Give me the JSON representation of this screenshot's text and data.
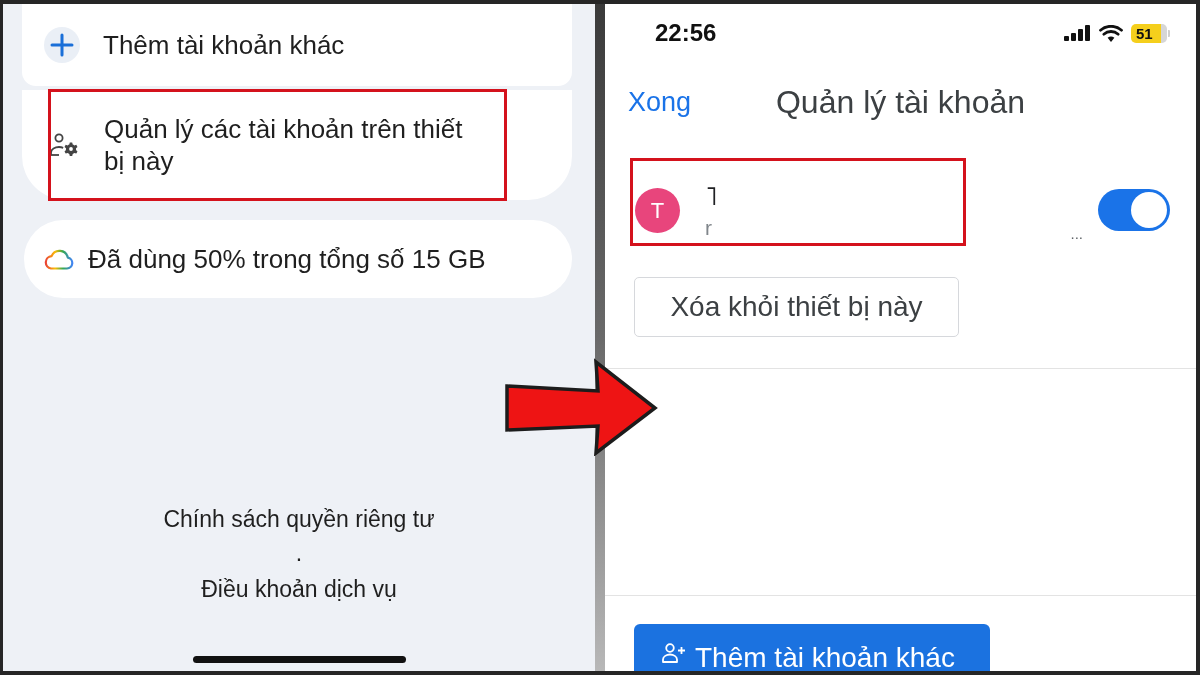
{
  "left_screen": {
    "add_account_item": {
      "label": "Thêm tài khoản khác"
    },
    "manage_accounts_item": {
      "label": "Quản lý các tài khoản trên thiết bị này"
    },
    "storage": {
      "label": "Đã dùng 50% trong tổng số 15 GB"
    },
    "footer": {
      "privacy_link": "Chính sách quyền riêng tư",
      "separator": ".",
      "terms_link": "Điều khoản dịch vụ"
    }
  },
  "right_screen": {
    "status_bar": {
      "time": "22:56",
      "battery": "51"
    },
    "header": {
      "done_button": "Xong",
      "title": "Quản lý tài khoản"
    },
    "accounts": [
      {
        "avatar_letter": "T",
        "name": "˥",
        "email": "r",
        "ellipsis": "...",
        "on": true
      }
    ],
    "remove_button": "Xóa khỏi thiết bị này",
    "add_account_button": "Thêm tài khoản khác"
  }
}
